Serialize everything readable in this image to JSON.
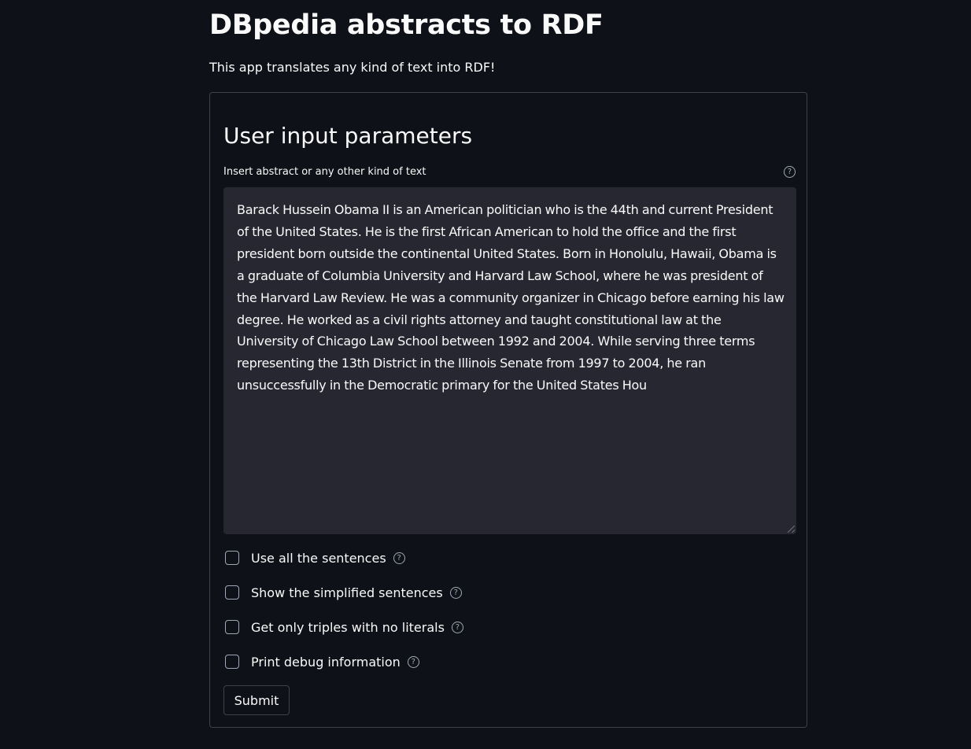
{
  "header": {
    "title": "DBpedia abstracts to RDF",
    "subtitle": "This app translates any kind of text into RDF!"
  },
  "form": {
    "heading": "User input parameters",
    "text_label": "Insert abstract or any other kind of text",
    "text_value": "Barack Hussein Obama II is an American politician who is the 44th and current President of the United States. He is the first African American to hold the office and the first president born outside the continental United States. Born in Honolulu, Hawaii, Obama is a graduate of Columbia University and Harvard Law School, where he was president of the Harvard Law Review. He was a community organizer in Chicago before earning his law degree. He worked as a civil rights attorney and taught constitutional law at the University of Chicago Law School between 1992 and 2004. While serving three terms representing the 13th District in the Illinois Senate from 1997 to 2004, he ran unsuccessfully in the Democratic primary for the United States Hou",
    "help_icon": "question-circle-icon",
    "options": [
      {
        "label": "Use all the sentences",
        "checked": false
      },
      {
        "label": "Show the simplified sentences",
        "checked": false
      },
      {
        "label": "Get only triples with no literals",
        "checked": false
      },
      {
        "label": "Print debug information",
        "checked": false
      }
    ],
    "submit_label": "Submit"
  },
  "colors": {
    "background": "#0e1117",
    "text": "#fafafa",
    "input_background": "#262730",
    "border": "#3d414a",
    "muted": "#a3a8b8"
  }
}
